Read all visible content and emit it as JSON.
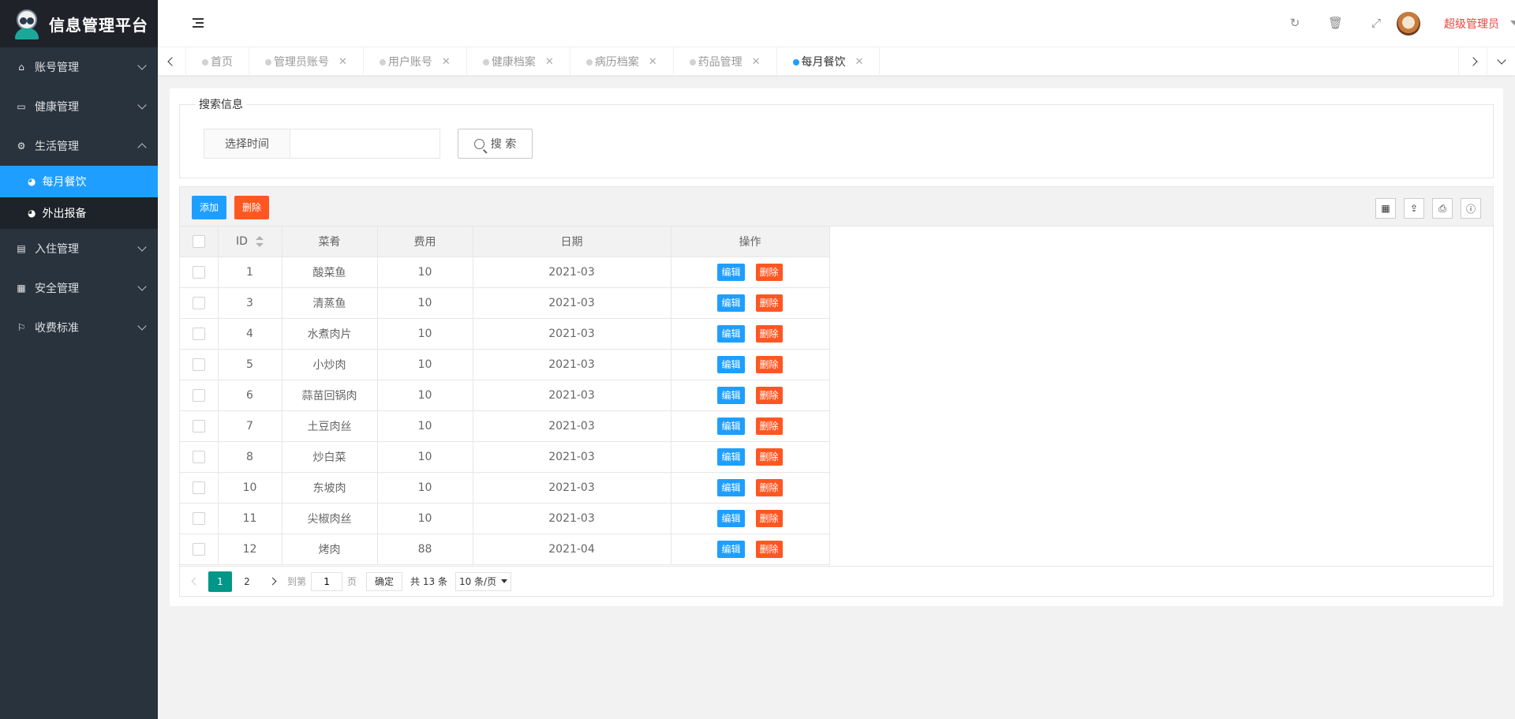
{
  "app": {
    "title": "信息管理平台"
  },
  "sidebar": {
    "items": [
      {
        "label": "账号管理",
        "icon": "home-icon",
        "expanded": false
      },
      {
        "label": "健康管理",
        "icon": "window-icon",
        "expanded": false
      },
      {
        "label": "生活管理",
        "icon": "gears-icon",
        "expanded": true,
        "children": [
          {
            "label": "每月餐饮",
            "icon": "dashboard-icon",
            "active": true
          },
          {
            "label": "外出报备",
            "icon": "dashboard-icon",
            "active": false
          }
        ]
      },
      {
        "label": "入住管理",
        "icon": "file-icon",
        "expanded": false
      },
      {
        "label": "安全管理",
        "icon": "calendar-icon",
        "expanded": false
      },
      {
        "label": "收费标准",
        "icon": "flag-icon",
        "expanded": false
      }
    ]
  },
  "header": {
    "username": "超级管理员",
    "icons": [
      "refresh-icon",
      "trash-icon",
      "fullscreen-icon"
    ]
  },
  "tabs": [
    {
      "label": "首页",
      "closable": false,
      "active": false
    },
    {
      "label": "管理员账号",
      "closable": true,
      "active": false
    },
    {
      "label": "用户账号",
      "closable": true,
      "active": false
    },
    {
      "label": "健康档案",
      "closable": true,
      "active": false
    },
    {
      "label": "病历档案",
      "closable": true,
      "active": false
    },
    {
      "label": "药品管理",
      "closable": true,
      "active": false
    },
    {
      "label": "每月餐饮",
      "closable": true,
      "active": true
    }
  ],
  "search": {
    "legend": "搜索信息",
    "date_label": "选择时间",
    "date_value": "",
    "button_label": "搜 索"
  },
  "toolbar": {
    "add_label": "添加",
    "delete_label": "删除",
    "tool_icons": [
      "columns-icon",
      "export-icon",
      "print-icon",
      "info-icon"
    ]
  },
  "table": {
    "columns": [
      "ID",
      "菜肴",
      "费用",
      "日期",
      "操作"
    ],
    "edit_label": "编辑",
    "delete_label": "删除",
    "rows": [
      {
        "id": "1",
        "dish": "酸菜鱼",
        "cost": "10",
        "date": "2021-03"
      },
      {
        "id": "3",
        "dish": "清蒸鱼",
        "cost": "10",
        "date": "2021-03"
      },
      {
        "id": "4",
        "dish": "水煮肉片",
        "cost": "10",
        "date": "2021-03"
      },
      {
        "id": "5",
        "dish": "小炒肉",
        "cost": "10",
        "date": "2021-03"
      },
      {
        "id": "6",
        "dish": "蒜苗回锅肉",
        "cost": "10",
        "date": "2021-03"
      },
      {
        "id": "7",
        "dish": "土豆肉丝",
        "cost": "10",
        "date": "2021-03"
      },
      {
        "id": "8",
        "dish": "炒白菜",
        "cost": "10",
        "date": "2021-03"
      },
      {
        "id": "10",
        "dish": "东坡肉",
        "cost": "10",
        "date": "2021-03"
      },
      {
        "id": "11",
        "dish": "尖椒肉丝",
        "cost": "10",
        "date": "2021-03"
      },
      {
        "id": "12",
        "dish": "烤肉",
        "cost": "88",
        "date": "2021-04"
      }
    ]
  },
  "pager": {
    "pages": [
      "1",
      "2"
    ],
    "current": "1",
    "goto_prefix": "到第",
    "goto_value": "1",
    "goto_suffix": "页",
    "confirm_label": "确定",
    "total_label": "共 13 条",
    "page_size_label": "10 条/页"
  },
  "colors": {
    "sidebar_bg": "#28333e",
    "accent_blue": "#1e9fff",
    "danger": "#ff5722",
    "pager_current": "#009688",
    "username": "#e8453c"
  }
}
